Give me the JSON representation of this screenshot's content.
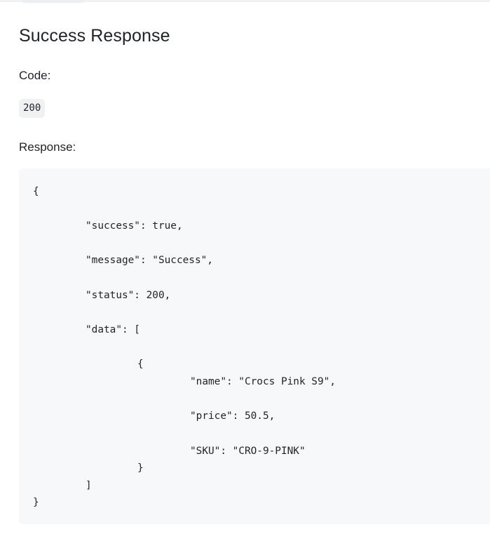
{
  "section": {
    "title": "Success Response",
    "code_label": "Code:",
    "code_value": "200",
    "response_label": "Response:"
  },
  "response_json": {
    "lines": [
      "{",
      "\"success\": true,",
      "\"message\": \"Success\",",
      "\"status\": 200,",
      "\"data\": [",
      "{",
      "\"name\": \"Crocs Pink S9\",",
      "\"price\": 50.5,",
      "\"SKU\": \"CRO-9-PINK\"",
      "}",
      "]",
      "}"
    ]
  },
  "colors": {
    "text": "#1f2328",
    "code_background": "#f6f8fa",
    "inline_code_background": "#eff1f3",
    "divider": "#d8dee4"
  }
}
